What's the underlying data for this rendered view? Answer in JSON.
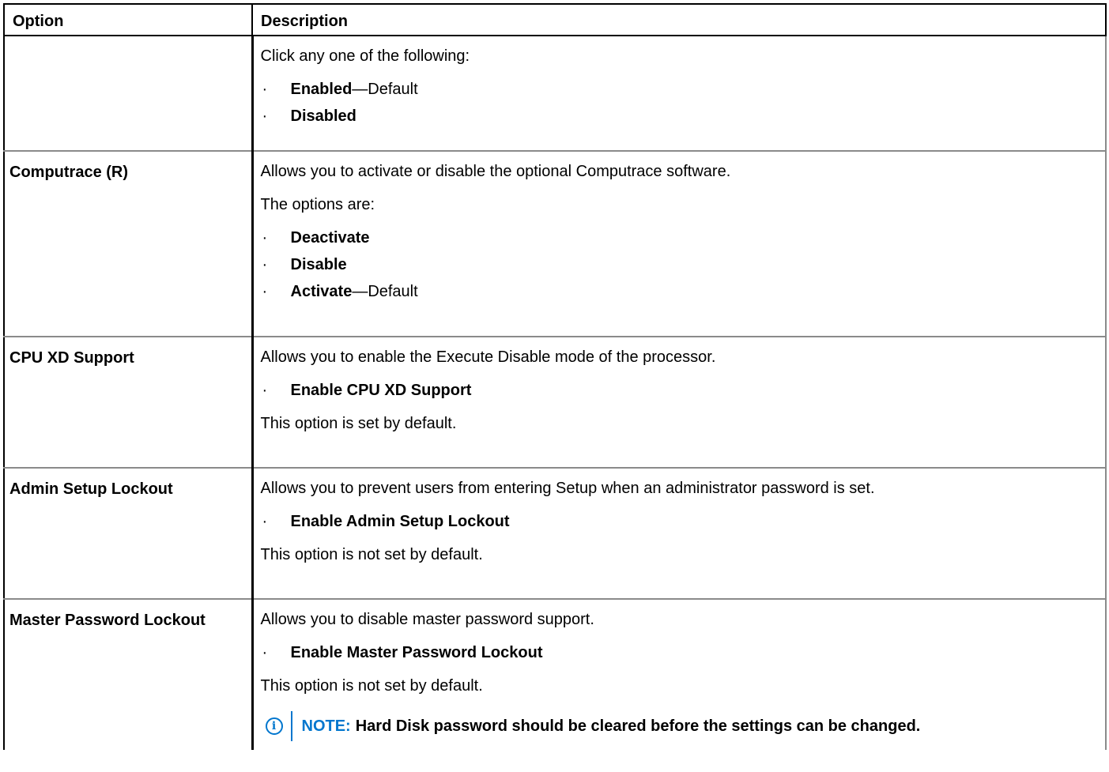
{
  "header": {
    "col_option": "Option",
    "col_description": "Description"
  },
  "rows": [
    {
      "option": "",
      "paragraphs_before": [
        "Click any one of the following:"
      ],
      "items": [
        {
          "label": "Enabled",
          "suffix": "—Default"
        },
        {
          "label": "Disabled",
          "suffix": ""
        }
      ],
      "paragraphs_after": []
    },
    {
      "option": "Computrace (R)",
      "paragraphs_before": [
        "Allows you to activate or disable the optional Computrace software.",
        "The options are:"
      ],
      "items": [
        {
          "label": "Deactivate",
          "suffix": ""
        },
        {
          "label": "Disable",
          "suffix": ""
        },
        {
          "label": "Activate",
          "suffix": "—Default"
        }
      ],
      "paragraphs_after": []
    },
    {
      "option": "CPU XD Support",
      "paragraphs_before": [
        "Allows you to enable the Execute Disable mode of the processor."
      ],
      "items": [
        {
          "label": "Enable CPU XD Support",
          "suffix": ""
        }
      ],
      "paragraphs_after": [
        "This option is set by default."
      ]
    },
    {
      "option": "Admin Setup Lockout",
      "paragraphs_before": [
        "Allows you to prevent users from entering Setup when an administrator password is set."
      ],
      "items": [
        {
          "label": "Enable Admin Setup Lockout",
          "suffix": ""
        }
      ],
      "paragraphs_after": [
        "This option is not set by default."
      ]
    },
    {
      "option": "Master Password Lockout",
      "paragraphs_before": [
        "Allows you to disable master password support."
      ],
      "items": [
        {
          "label": "Enable Master Password Lockout",
          "suffix": ""
        }
      ],
      "paragraphs_after": [
        "This option is not set by default."
      ],
      "note": {
        "label": "NOTE:",
        "text": "Hard Disk password should be cleared before the settings can be changed."
      }
    }
  ],
  "bullet_glyph": "·",
  "note_icon_glyph": "i",
  "colors": {
    "note_accent": "#0076ce",
    "row_border": "#8a8a8a"
  },
  "icons": {
    "note": "info-icon"
  }
}
